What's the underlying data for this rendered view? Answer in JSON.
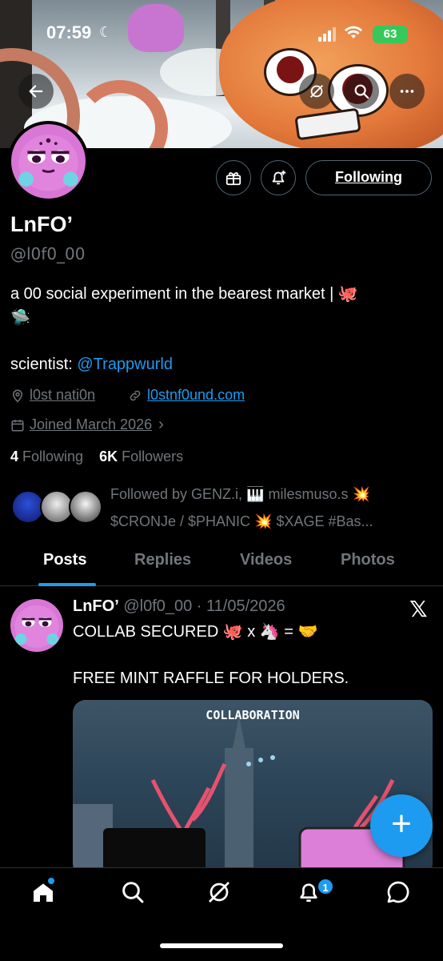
{
  "status_bar": {
    "time": "07:59",
    "battery": "63"
  },
  "profile": {
    "name": "LnFO’",
    "handle": "@l0f0_00",
    "bio_line": "a 00 social experiment in the bearest market | 🐙",
    "bio_emoji": "🛸",
    "scientist_label": "scientist:",
    "scientist_link": "@Trappwurld",
    "location": "l0st nati0n",
    "website": "l0stnf0und.com",
    "joined": "Joined March 2026",
    "following_count": "4",
    "following_label": "Following",
    "followers_count": "6K",
    "followers_label": "Followers",
    "followed_by": "Followed by GENZ.i, 🎹 milesmuso.s 💥 $CRONJe / $PHANIC 💥 $XAGE #Bas..."
  },
  "buttons": {
    "following": "Following"
  },
  "tabs": [
    {
      "label": "Posts",
      "active": true
    },
    {
      "label": "Replies",
      "active": false
    },
    {
      "label": "Videos",
      "active": false
    },
    {
      "label": "Photos",
      "active": false
    }
  ],
  "post": {
    "author": "LnFO’",
    "handle_date": "@l0f0_00 · 11/05/2026",
    "line1": "COLLAB SECURED 🐙 x 🦄 = 🤝",
    "line2": "FREE MINT RAFFLE FOR HOLDERS.",
    "media_title": "COLLABORATION"
  },
  "fab": {
    "label": "+"
  },
  "bottom_nav": {
    "notification_badge": "1"
  },
  "colors": {
    "accent": "#1d9bf0",
    "muted": "#71767b",
    "background": "#000000"
  }
}
